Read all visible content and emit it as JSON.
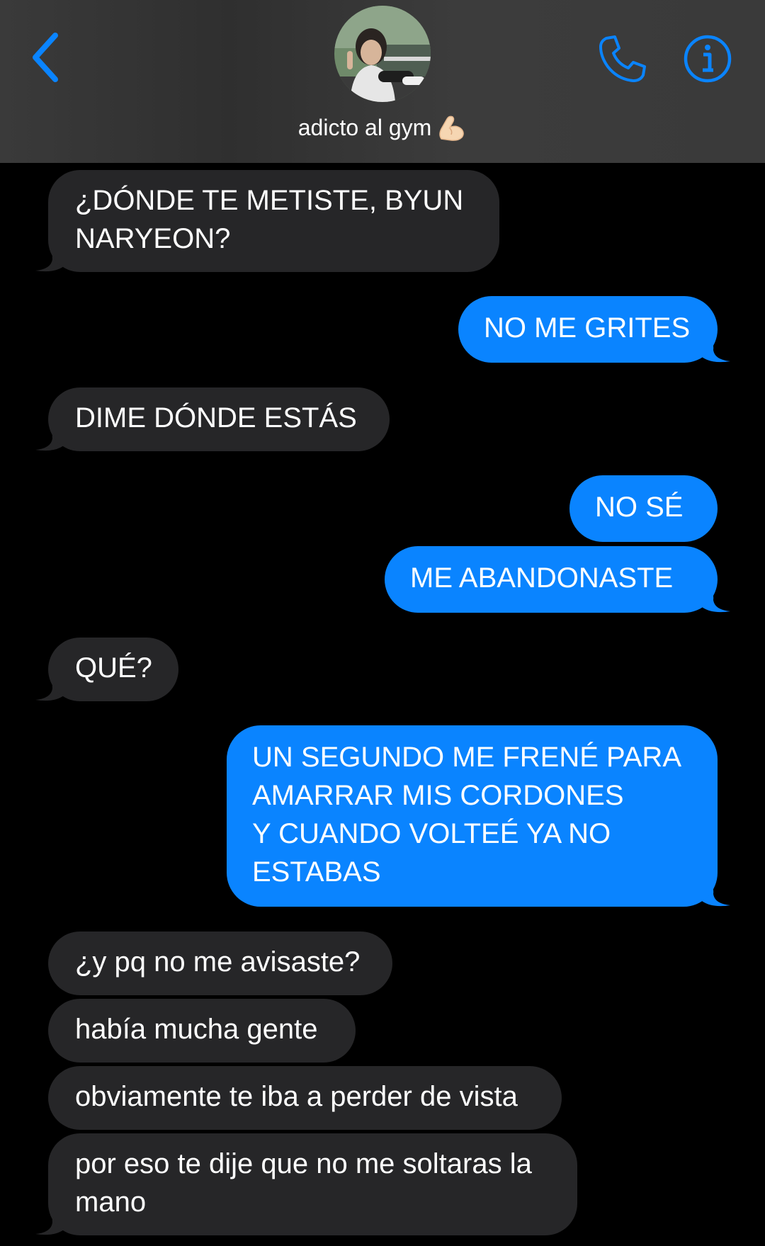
{
  "header": {
    "contact_name": "adicto al gym",
    "back_icon": "chevron-left-icon",
    "call_icon": "phone-icon",
    "info_icon": "info-icon",
    "name_emoji_icon": "flexed-biceps-icon",
    "accent_color": "#0a84ff"
  },
  "messages": [
    {
      "sender": "contact",
      "lines": [
        "¿DÓNDE TE METISTE, BYUN",
        "NARYEON?"
      ]
    },
    {
      "sender": "me",
      "lines": [
        "NO ME GRITES"
      ]
    },
    {
      "sender": "contact",
      "lines": [
        "DIME DÓNDE ESTÁS"
      ]
    },
    {
      "sender": "me",
      "lines": [
        "NO SÉ"
      ]
    },
    {
      "sender": "me",
      "lines": [
        "ME ABANDONASTE"
      ]
    },
    {
      "sender": "contact",
      "lines": [
        "QUÉ?"
      ]
    },
    {
      "sender": "me",
      "lines": [
        "UN SEGUNDO ME FRENÉ PARA",
        "AMARRAR MIS CORDONES",
        "Y CUANDO VOLTEÉ YA NO",
        "ESTABAS"
      ]
    },
    {
      "sender": "contact",
      "lines": [
        "¿y pq no me avisaste?"
      ]
    },
    {
      "sender": "contact",
      "lines": [
        "había mucha gente"
      ]
    },
    {
      "sender": "contact",
      "lines": [
        "obviamente te iba a perder de vista"
      ]
    },
    {
      "sender": "contact",
      "lines": [
        "por eso te dije que no me soltaras la",
        "mano"
      ]
    }
  ],
  "colors": {
    "incoming_bubble": "#262628",
    "outgoing_bubble": "#0a84ff",
    "background": "#000000"
  }
}
